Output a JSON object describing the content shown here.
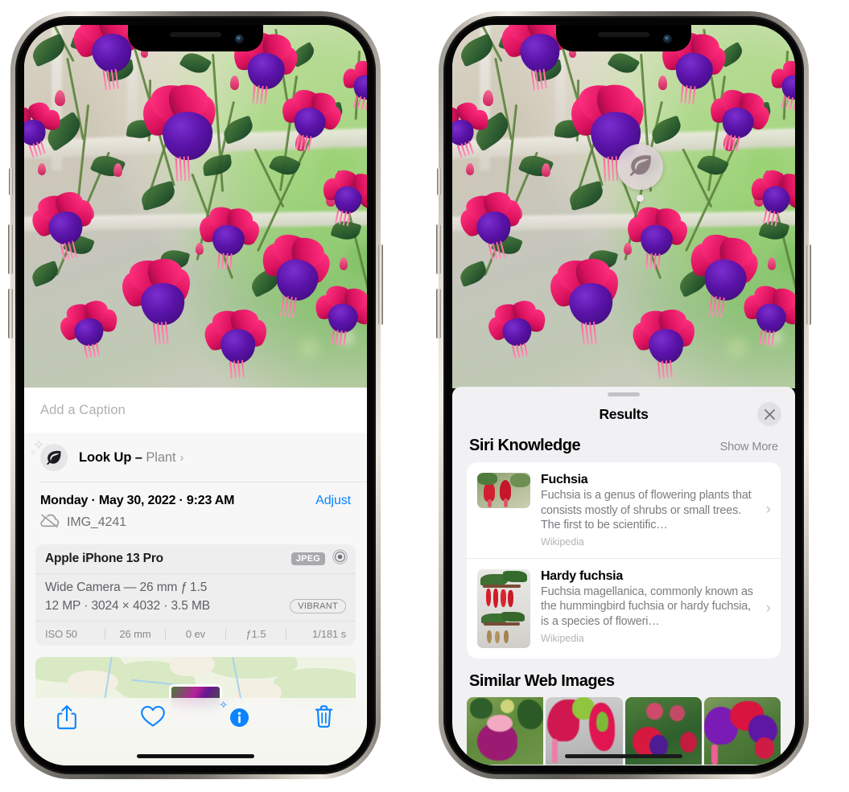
{
  "meta": {
    "accent_blue": "#0a84ff",
    "sheet_bg": "#f7f7f7",
    "results_bg": "#f1f1f4"
  },
  "left_phone": {
    "caption": {
      "placeholder": "Add a Caption",
      "value": ""
    },
    "look_up": {
      "label": "Look Up",
      "dash": "–",
      "subject": "Plant",
      "chevron": "›",
      "icon": "leaf-icon"
    },
    "info": {
      "date_line": "Monday · May 30, 2022 · 9:23 AM",
      "adjust_label": "Adjust",
      "filename": "IMG_4241",
      "cloud_icon": "icloud-slash-icon"
    },
    "camera": {
      "model": "Apple iPhone 13 Pro",
      "format_badge": "JPEG",
      "lens_icon": "camera-lens-icon",
      "lens_line": "Wide Camera — 26 mm ƒ 1.5",
      "specs_line": "12 MP · 3024 × 4032 · 3.5 MB",
      "profile_badge": "VIBRANT",
      "exif": [
        "ISO 50",
        "26 mm",
        "0 ev",
        "ƒ1.5",
        "1/181 s"
      ]
    },
    "map": {
      "label": "photo-location-map"
    },
    "toolbar": [
      {
        "name": "share-button",
        "icon": "share-icon"
      },
      {
        "name": "favorite-button",
        "icon": "heart-icon"
      },
      {
        "name": "info-button",
        "icon": "info-sparkle-icon"
      },
      {
        "name": "delete-button",
        "icon": "trash-icon"
      }
    ]
  },
  "right_phone": {
    "visual_lookup_badge": {
      "icon": "leaf-icon",
      "label": "visual-look-up-indicator"
    },
    "sheet": {
      "grabber": "drag-handle",
      "title": "Results",
      "close_label": "✕"
    },
    "siri_knowledge": {
      "title": "Siri Knowledge",
      "show_more": "Show More",
      "results": [
        {
          "title": "Fuchsia",
          "description": "Fuchsia is a genus of flowering plants that consists mostly of shrubs or small trees. The first to be scientific…",
          "source": "Wikipedia",
          "chevron": "›"
        },
        {
          "title": "Hardy fuchsia",
          "description": "Fuchsia magellanica, commonly known as the hummingbird fuchsia or hardy fuchsia, is a species of floweri…",
          "source": "Wikipedia",
          "chevron": "›"
        }
      ]
    },
    "similar_web_images": {
      "title": "Similar Web Images",
      "count": 4
    }
  }
}
